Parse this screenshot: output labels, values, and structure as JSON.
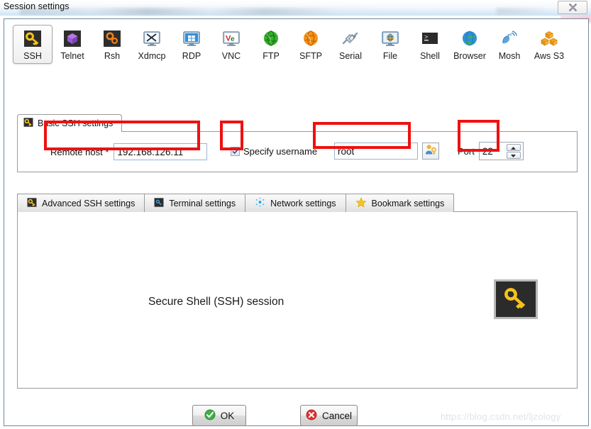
{
  "window": {
    "title": "Session settings",
    "close_icon": "close-icon"
  },
  "protocols": [
    {
      "label": "SSH",
      "icon": "key-icon",
      "selected": true
    },
    {
      "label": "Telnet",
      "icon": "purple-cube-icon",
      "selected": false
    },
    {
      "label": "Rsh",
      "icon": "orange-gears-icon",
      "selected": false
    },
    {
      "label": "Xdmcp",
      "icon": "x-monitor-icon",
      "selected": false
    },
    {
      "label": "RDP",
      "icon": "windows-monitor-icon",
      "selected": false
    },
    {
      "label": "VNC",
      "icon": "vnc-monitor-icon",
      "selected": false
    },
    {
      "label": "FTP",
      "icon": "green-globe-icon",
      "selected": false
    },
    {
      "label": "SFTP",
      "icon": "orange-globe-icon",
      "selected": false
    },
    {
      "label": "Serial",
      "icon": "serial-plug-icon",
      "selected": false
    },
    {
      "label": "File",
      "icon": "file-monitor-icon",
      "selected": false
    },
    {
      "label": "Shell",
      "icon": "terminal-icon",
      "selected": false
    },
    {
      "label": "Browser",
      "icon": "blue-globe-icon",
      "selected": false
    },
    {
      "label": "Mosh",
      "icon": "satellite-dish-icon",
      "selected": false
    },
    {
      "label": "Aws S3",
      "icon": "aws-boxes-icon",
      "selected": false
    }
  ],
  "basic_tab": {
    "label": "Basic SSH settings",
    "icon": "key-icon"
  },
  "basic_form": {
    "remote_host_label": "Remote host *",
    "remote_host_value": "192.168.126.11",
    "specify_username_label": "Specify username",
    "specify_username_checked": true,
    "username_value": "root",
    "username_placeholder": "",
    "user_picker_icon": "user-key-icon",
    "port_label": "Port",
    "port_value": "22",
    "spinner_up_icon": "triangle-up-icon",
    "spinner_down_icon": "triangle-down-icon"
  },
  "lower_tabs": [
    {
      "label": "Advanced SSH settings",
      "icon": "key-icon"
    },
    {
      "label": "Terminal settings",
      "icon": "terminal-blue-icon"
    },
    {
      "label": "Network settings",
      "icon": "network-dots-icon"
    },
    {
      "label": "Bookmark settings",
      "icon": "star-icon"
    }
  ],
  "content": {
    "caption": "Secure Shell (SSH) session",
    "badge_icon": "key-icon"
  },
  "buttons": {
    "ok_label": "OK",
    "ok_icon": "green-check-icon",
    "cancel_label": "Cancel",
    "cancel_icon": "red-x-icon"
  },
  "annotations": {
    "color": "#ee1111",
    "boxes": [
      "remote-host",
      "specify-username-checkbox",
      "username-field",
      "port-field"
    ]
  },
  "watermark": {
    "text": "https://blog.csdn.net/ljzology"
  }
}
